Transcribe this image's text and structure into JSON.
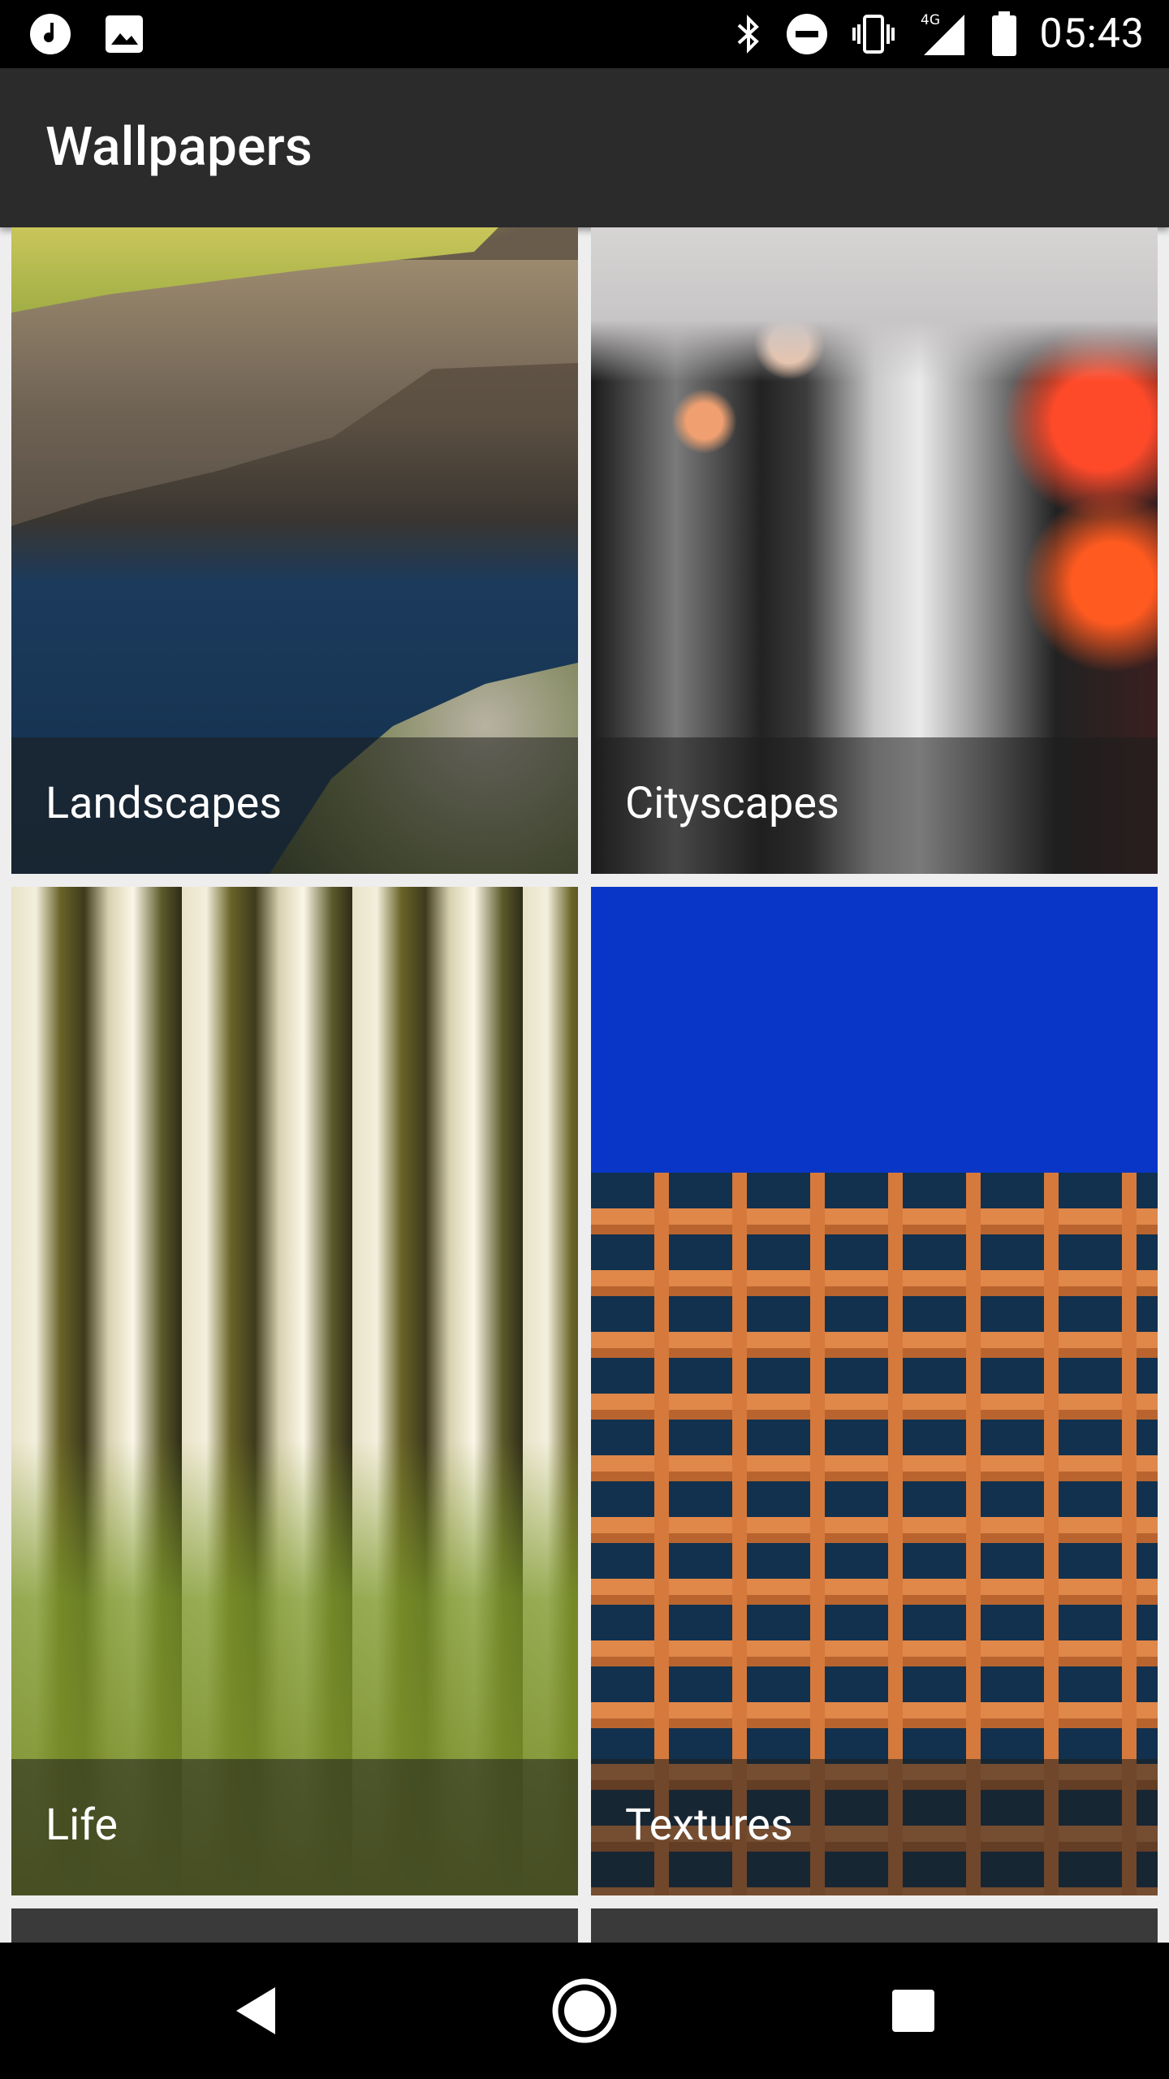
{
  "status_bar": {
    "time": "05:43",
    "left_icons": [
      "music-note-icon",
      "image-icon"
    ],
    "right_icons": [
      "bluetooth-icon",
      "do-not-disturb-icon",
      "vibrate-icon",
      "signal-4g-icon",
      "battery-icon"
    ],
    "network_label": "4G"
  },
  "app_bar": {
    "title": "Wallpapers"
  },
  "categories": [
    {
      "label": "Landscapes"
    },
    {
      "label": "Cityscapes"
    },
    {
      "label": "Life"
    },
    {
      "label": "Textures"
    }
  ],
  "nav_bar": {
    "icons": [
      "back-icon",
      "home-icon",
      "recents-icon"
    ]
  }
}
